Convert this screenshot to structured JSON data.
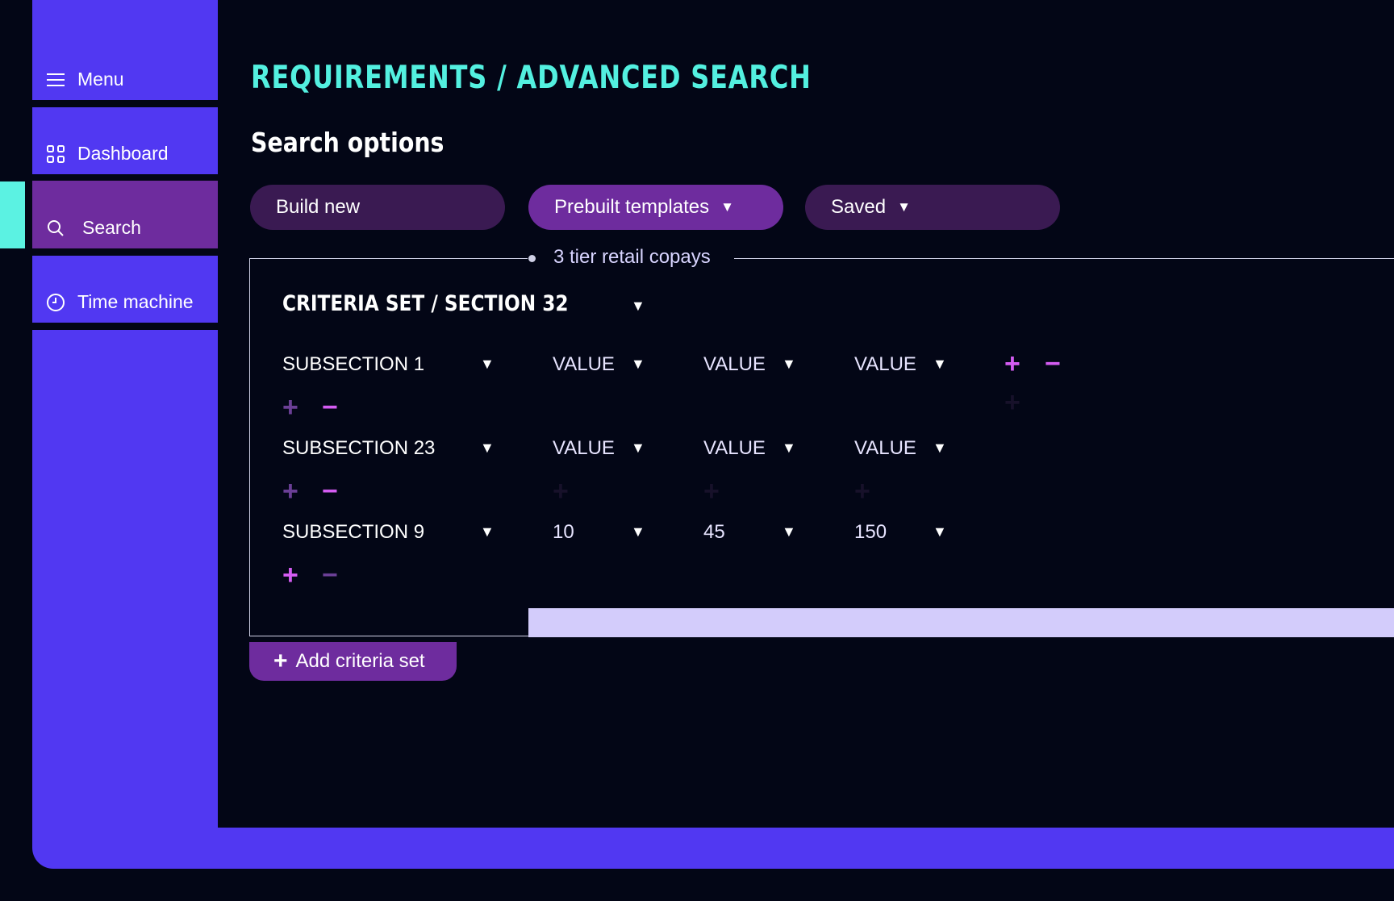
{
  "sidebar": {
    "items": [
      {
        "label": "Menu",
        "icon": "hamburger-icon"
      },
      {
        "label": "Dashboard",
        "icon": "grid-icon"
      },
      {
        "label": "Search",
        "icon": "search-icon",
        "active": true
      },
      {
        "label": "Time machine",
        "icon": "clock-icon"
      }
    ]
  },
  "header": {
    "breadcrumb": "REQUIREMENTS / ADVANCED SEARCH",
    "section_title": "Search options"
  },
  "options": {
    "build_new": "Build new",
    "prebuilt": "Prebuilt templates",
    "saved": "Saved"
  },
  "template_name": "3 tier retail copays",
  "criteria": {
    "title": "CRITERIA SET / SECTION 32",
    "rows": [
      {
        "subsection": "SUBSECTION 1",
        "v1": "VALUE",
        "v2": "VALUE",
        "v3": "VALUE"
      },
      {
        "subsection": "SUBSECTION 23",
        "v1": "VALUE",
        "v2": "VALUE",
        "v3": "VALUE"
      },
      {
        "subsection": "SUBSECTION 9",
        "v1": "10",
        "v2": "45",
        "v3": "150"
      }
    ]
  },
  "add_criteria_set": "Add criteria set",
  "colors": {
    "accent": "#5138f2",
    "highlight": "#53f0e0",
    "purple": "#6e2c9e",
    "background": "#030616"
  }
}
